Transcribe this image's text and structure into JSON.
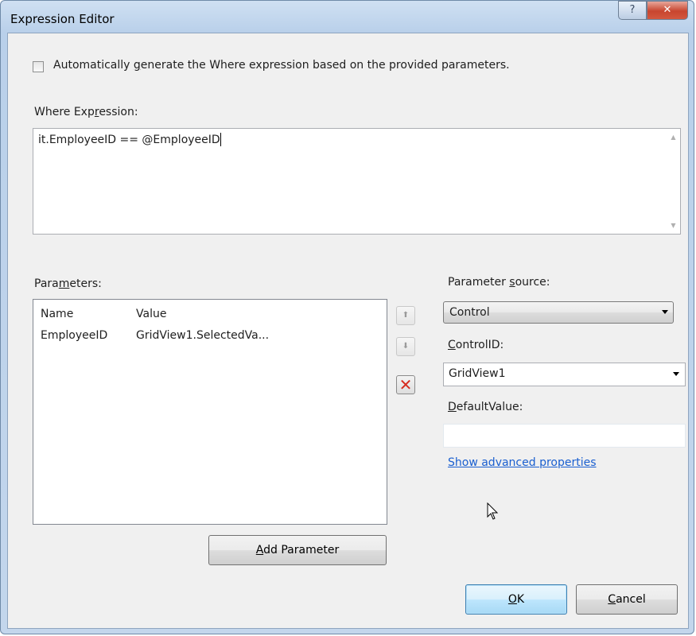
{
  "window": {
    "title": "Expression Editor",
    "help_glyph": "?",
    "close_glyph": "✕"
  },
  "auto_generate": {
    "checked": false,
    "label_pre": "Automatically ",
    "label_accel": "g",
    "label_post": "enerate the Where expression based on the provided parameters."
  },
  "where": {
    "label_pre": "Where Exp",
    "label_accel": "r",
    "label_post": "ession:",
    "value": "it.EmployeeID == @EmployeeID"
  },
  "parameters": {
    "label_pre": "Para",
    "label_accel": "m",
    "label_post": "eters:",
    "columns": [
      "Name",
      "Value"
    ],
    "rows": [
      {
        "name": "EmployeeID",
        "value": "GridView1.SelectedVa..."
      }
    ],
    "add_button_accel": "A",
    "add_button_post": "dd Parameter"
  },
  "move_up_glyph": "⬆",
  "move_down_glyph": "⬇",
  "delete_glyph": "✕",
  "parameter_source": {
    "label_pre": "Parameter ",
    "label_accel": "s",
    "label_post": "ource:",
    "selected": "Control"
  },
  "control_id": {
    "label_accel": "C",
    "label_post": "ontrolID:",
    "selected": "GridView1"
  },
  "default_value": {
    "label_accel": "D",
    "label_post": "efaultValue:",
    "value": ""
  },
  "advanced_link": "Show advanced properties",
  "footer": {
    "ok_accel": "O",
    "ok_post": "K",
    "cancel_accel": "C",
    "cancel_post": "ancel"
  },
  "colors": {
    "accent_link": "#1a5fd0",
    "close_button": "#c8452f",
    "delete_x": "#d62b1e"
  }
}
